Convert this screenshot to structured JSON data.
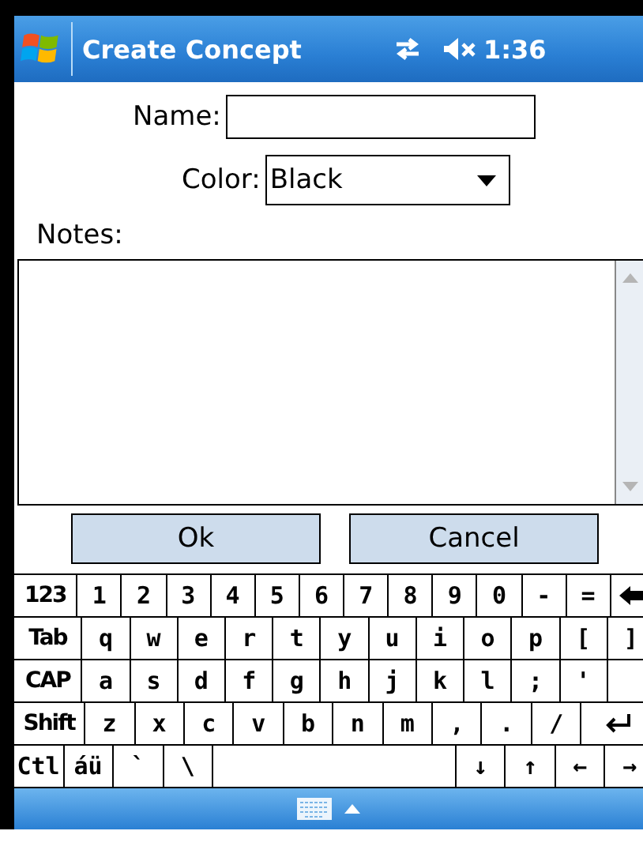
{
  "title_bar": {
    "title": "Create Concept",
    "time": "1:36",
    "sound_muted": true
  },
  "form": {
    "name_label": "Name:",
    "color_label": "Color:",
    "color_value": "Black",
    "notes_label": "Notes:"
  },
  "buttons": [
    {
      "label": "Ok"
    },
    {
      "label": "Cancel"
    }
  ],
  "keyboard": [
    [
      {
        "label": "123",
        "kind": "wide"
      },
      {
        "label": "1",
        "kind": "key"
      },
      {
        "label": "2",
        "kind": "key"
      },
      {
        "label": "3",
        "kind": "key"
      },
      {
        "label": "4",
        "kind": "key"
      },
      {
        "label": "5",
        "kind": "key"
      },
      {
        "label": "6",
        "kind": "key"
      },
      {
        "label": "7",
        "kind": "key"
      },
      {
        "label": "8",
        "kind": "key"
      },
      {
        "label": "9",
        "kind": "key"
      },
      {
        "label": "0",
        "kind": "key"
      },
      {
        "label": "-",
        "kind": "key"
      },
      {
        "label": "=",
        "kind": "key"
      },
      {
        "kind": "backspace"
      }
    ],
    [
      {
        "label": "Tab",
        "kind": "wide"
      },
      {
        "label": "q",
        "kind": "key"
      },
      {
        "label": "w",
        "kind": "key"
      },
      {
        "label": "e",
        "kind": "key"
      },
      {
        "label": "r",
        "kind": "key"
      },
      {
        "label": "t",
        "kind": "key"
      },
      {
        "label": "y",
        "kind": "key"
      },
      {
        "label": "u",
        "kind": "key"
      },
      {
        "label": "i",
        "kind": "key"
      },
      {
        "label": "o",
        "kind": "key"
      },
      {
        "label": "p",
        "kind": "key"
      },
      {
        "label": "[",
        "kind": "key"
      },
      {
        "label": "]",
        "kind": "key"
      }
    ],
    [
      {
        "label": "CAP",
        "kind": "wide"
      },
      {
        "label": "a",
        "kind": "key"
      },
      {
        "label": "s",
        "kind": "key"
      },
      {
        "label": "d",
        "kind": "key"
      },
      {
        "label": "f",
        "kind": "key"
      },
      {
        "label": "g",
        "kind": "key"
      },
      {
        "label": "h",
        "kind": "key"
      },
      {
        "label": "j",
        "kind": "key"
      },
      {
        "label": "k",
        "kind": "key"
      },
      {
        "label": "l",
        "kind": "key"
      },
      {
        "label": ";",
        "kind": "key"
      },
      {
        "label": "'",
        "kind": "key"
      },
      {
        "kind": "blank"
      }
    ],
    [
      {
        "label": "Shift",
        "kind": "wide"
      },
      {
        "label": "z",
        "kind": "key"
      },
      {
        "label": "x",
        "kind": "key"
      },
      {
        "label": "c",
        "kind": "key"
      },
      {
        "label": "v",
        "kind": "key"
      },
      {
        "label": "b",
        "kind": "key"
      },
      {
        "label": "n",
        "kind": "key"
      },
      {
        "label": "m",
        "kind": "key"
      },
      {
        "label": ",",
        "kind": "key"
      },
      {
        "label": ".",
        "kind": "key"
      },
      {
        "label": "/",
        "kind": "key"
      },
      {
        "kind": "enter"
      }
    ],
    [
      {
        "label": "Ctl",
        "kind": "key"
      },
      {
        "label": "áü",
        "kind": "key"
      },
      {
        "label": "`",
        "kind": "key"
      },
      {
        "label": "\\",
        "kind": "key"
      },
      {
        "kind": "space"
      },
      {
        "label": "↓",
        "kind": "key"
      },
      {
        "label": "↑",
        "kind": "key"
      },
      {
        "label": "←",
        "kind": "key"
      },
      {
        "label": "→",
        "kind": "key"
      }
    ]
  ]
}
